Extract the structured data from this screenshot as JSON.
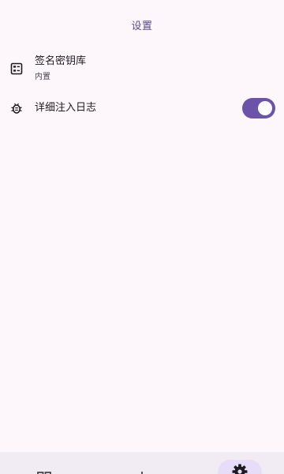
{
  "app_bar": {
    "title": "设置"
  },
  "settings": {
    "keystore": {
      "title": "签名密钥库",
      "value": "内置",
      "icon": "keystore-icon"
    },
    "verbose_log": {
      "title": "详细注入日志",
      "icon": "bug-icon",
      "enabled": true
    }
  },
  "bottom_nav": {
    "items": [
      {
        "id": "home",
        "icon": "home-icon",
        "selected": false
      },
      {
        "id": "patch",
        "icon": "patch-icon",
        "selected": false
      },
      {
        "id": "settings",
        "icon": "settings-gear-icon",
        "selected": true
      }
    ]
  },
  "colors": {
    "background": "#fdf7fc",
    "accent": "#6a53a8",
    "title": "#5b4a86",
    "nav_background": "#f1ebf3",
    "nav_indicator": "#e7ddf9"
  }
}
